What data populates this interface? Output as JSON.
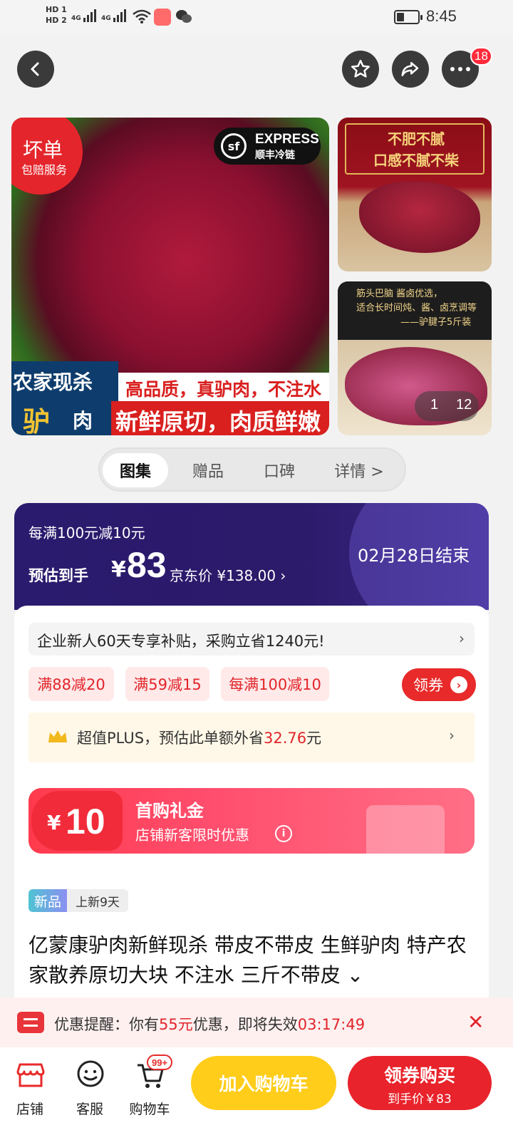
{
  "status_bar": {
    "hd1": "HD 1",
    "hd2": "HD 2",
    "net1": "4G",
    "net2": "4G",
    "time": "8:45"
  },
  "top_bar": {
    "badge_count": "18"
  },
  "gallery": {
    "main": {
      "bad_order_line1": "坏单",
      "bad_order_line2": "包赔服务",
      "sf_express": "EXPRESS",
      "sf_cold": "顺丰冷链",
      "farm_line1": "农家现杀",
      "farm_line2a": "驴",
      "farm_line2b": "肉",
      "band_top": "高品质，真驴肉，不注水",
      "band_bottom": "新鲜原切，肉质鲜嫩"
    },
    "side1": {
      "line1": "不肥不腻",
      "line2": "口感不腻不柴"
    },
    "side2": {
      "line1": "筋头巴脑 酱卤优选，",
      "line2": "适合长时间炖、酱、卤烹调等",
      "line3": "——驴腱子5斤装",
      "index": "1",
      "total": "12"
    }
  },
  "tabs": [
    {
      "label": "图集",
      "active": true
    },
    {
      "label": "赠品",
      "active": false
    },
    {
      "label": "口碑",
      "active": false
    },
    {
      "label": "详情 >",
      "active": false
    }
  ],
  "promo": {
    "deal": "每满100元减10元",
    "estimate_label": "预估到手",
    "currency": "¥",
    "price": "83",
    "jd_price": "京东价 ¥138.00 ›",
    "ends": "02月28日结束"
  },
  "card": {
    "new_user_text": "企业新人60天专享补贴，采购立省1240元!",
    "new_user_arrow": "›",
    "coupons": [
      "满88减20",
      "满59减15",
      "每满100减10"
    ],
    "get_coupon": "领券",
    "get_coupon_icon": "›",
    "plus_prefix": "超值PLUS，预估此单额外省",
    "plus_amount": "32.76",
    "plus_suffix": "元",
    "plus_arrow": "›",
    "gift_currency": "¥",
    "gift_amount": "10",
    "gift_title": "首购礼金",
    "gift_sub": "店铺新客限时优惠",
    "gift_info": "i",
    "new_tag": "新品",
    "new_days": "上新9天",
    "product_title": "亿蒙康驴肉新鲜现杀 带皮不带皮 生鲜驴肉 特产农家散养原切大块 不注水 三斤不带皮 ⌄"
  },
  "reminder": {
    "prefix": "优惠提醒：你有",
    "amount": "55元",
    "middle": "优惠，即将失效",
    "countdown": "03:17:49",
    "close": "✕"
  },
  "bottom_bar": {
    "shop_label": "店铺",
    "service_label": "客服",
    "cart_label": "购物车",
    "cart_badge": "99+",
    "add_to_cart": "加入购物车",
    "buy_title": "领券购买",
    "buy_sub": "到手价￥83"
  },
  "colors": {
    "accent_red": "#e8232b",
    "cart_yellow": "#ffcd1a",
    "promo_purple": "#2a1b6e"
  }
}
